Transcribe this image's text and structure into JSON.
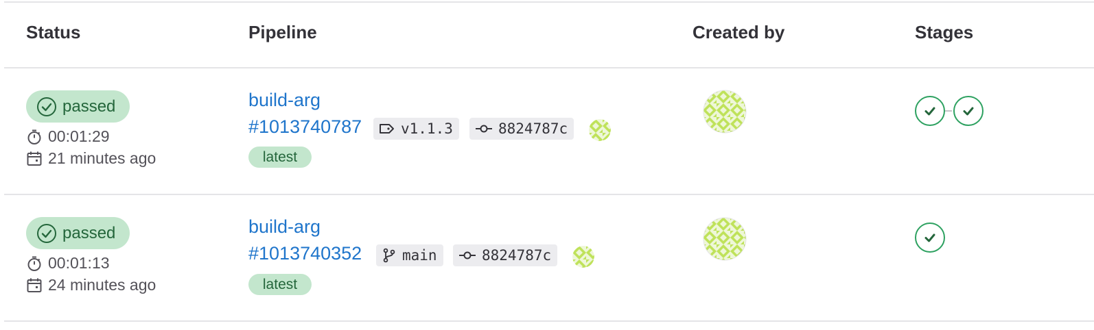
{
  "headers": {
    "status": "Status",
    "pipeline": "Pipeline",
    "created_by": "Created by",
    "stages": "Stages"
  },
  "rows": [
    {
      "status": "passed",
      "duration": "00:01:29",
      "finished": "21 minutes ago",
      "pipeline_name": "build-arg",
      "pipeline_id": "#1013740787",
      "ref_type": "tag",
      "ref": "v1.1.3",
      "commit": "8824787c",
      "badge": "latest",
      "stages": [
        "passed",
        "passed"
      ]
    },
    {
      "status": "passed",
      "duration": "00:01:13",
      "finished": "24 minutes ago",
      "pipeline_name": "build-arg",
      "pipeline_id": "#1013740352",
      "ref_type": "branch",
      "ref": "main",
      "commit": "8824787c",
      "badge": "latest",
      "stages": [
        "passed"
      ]
    }
  ],
  "icons": {
    "status": "check-circle-icon",
    "duration": "timer-icon",
    "finished": "calendar-icon",
    "tag": "tag-icon",
    "branch": "branch-icon",
    "commit": "commit-icon",
    "stage": "check-icon"
  },
  "colors": {
    "link": "#1f75cb",
    "success_bg": "#c3e6cd",
    "success_fg": "#24663b",
    "stage_border": "#2da160",
    "avatar": "#b7dd4f"
  }
}
